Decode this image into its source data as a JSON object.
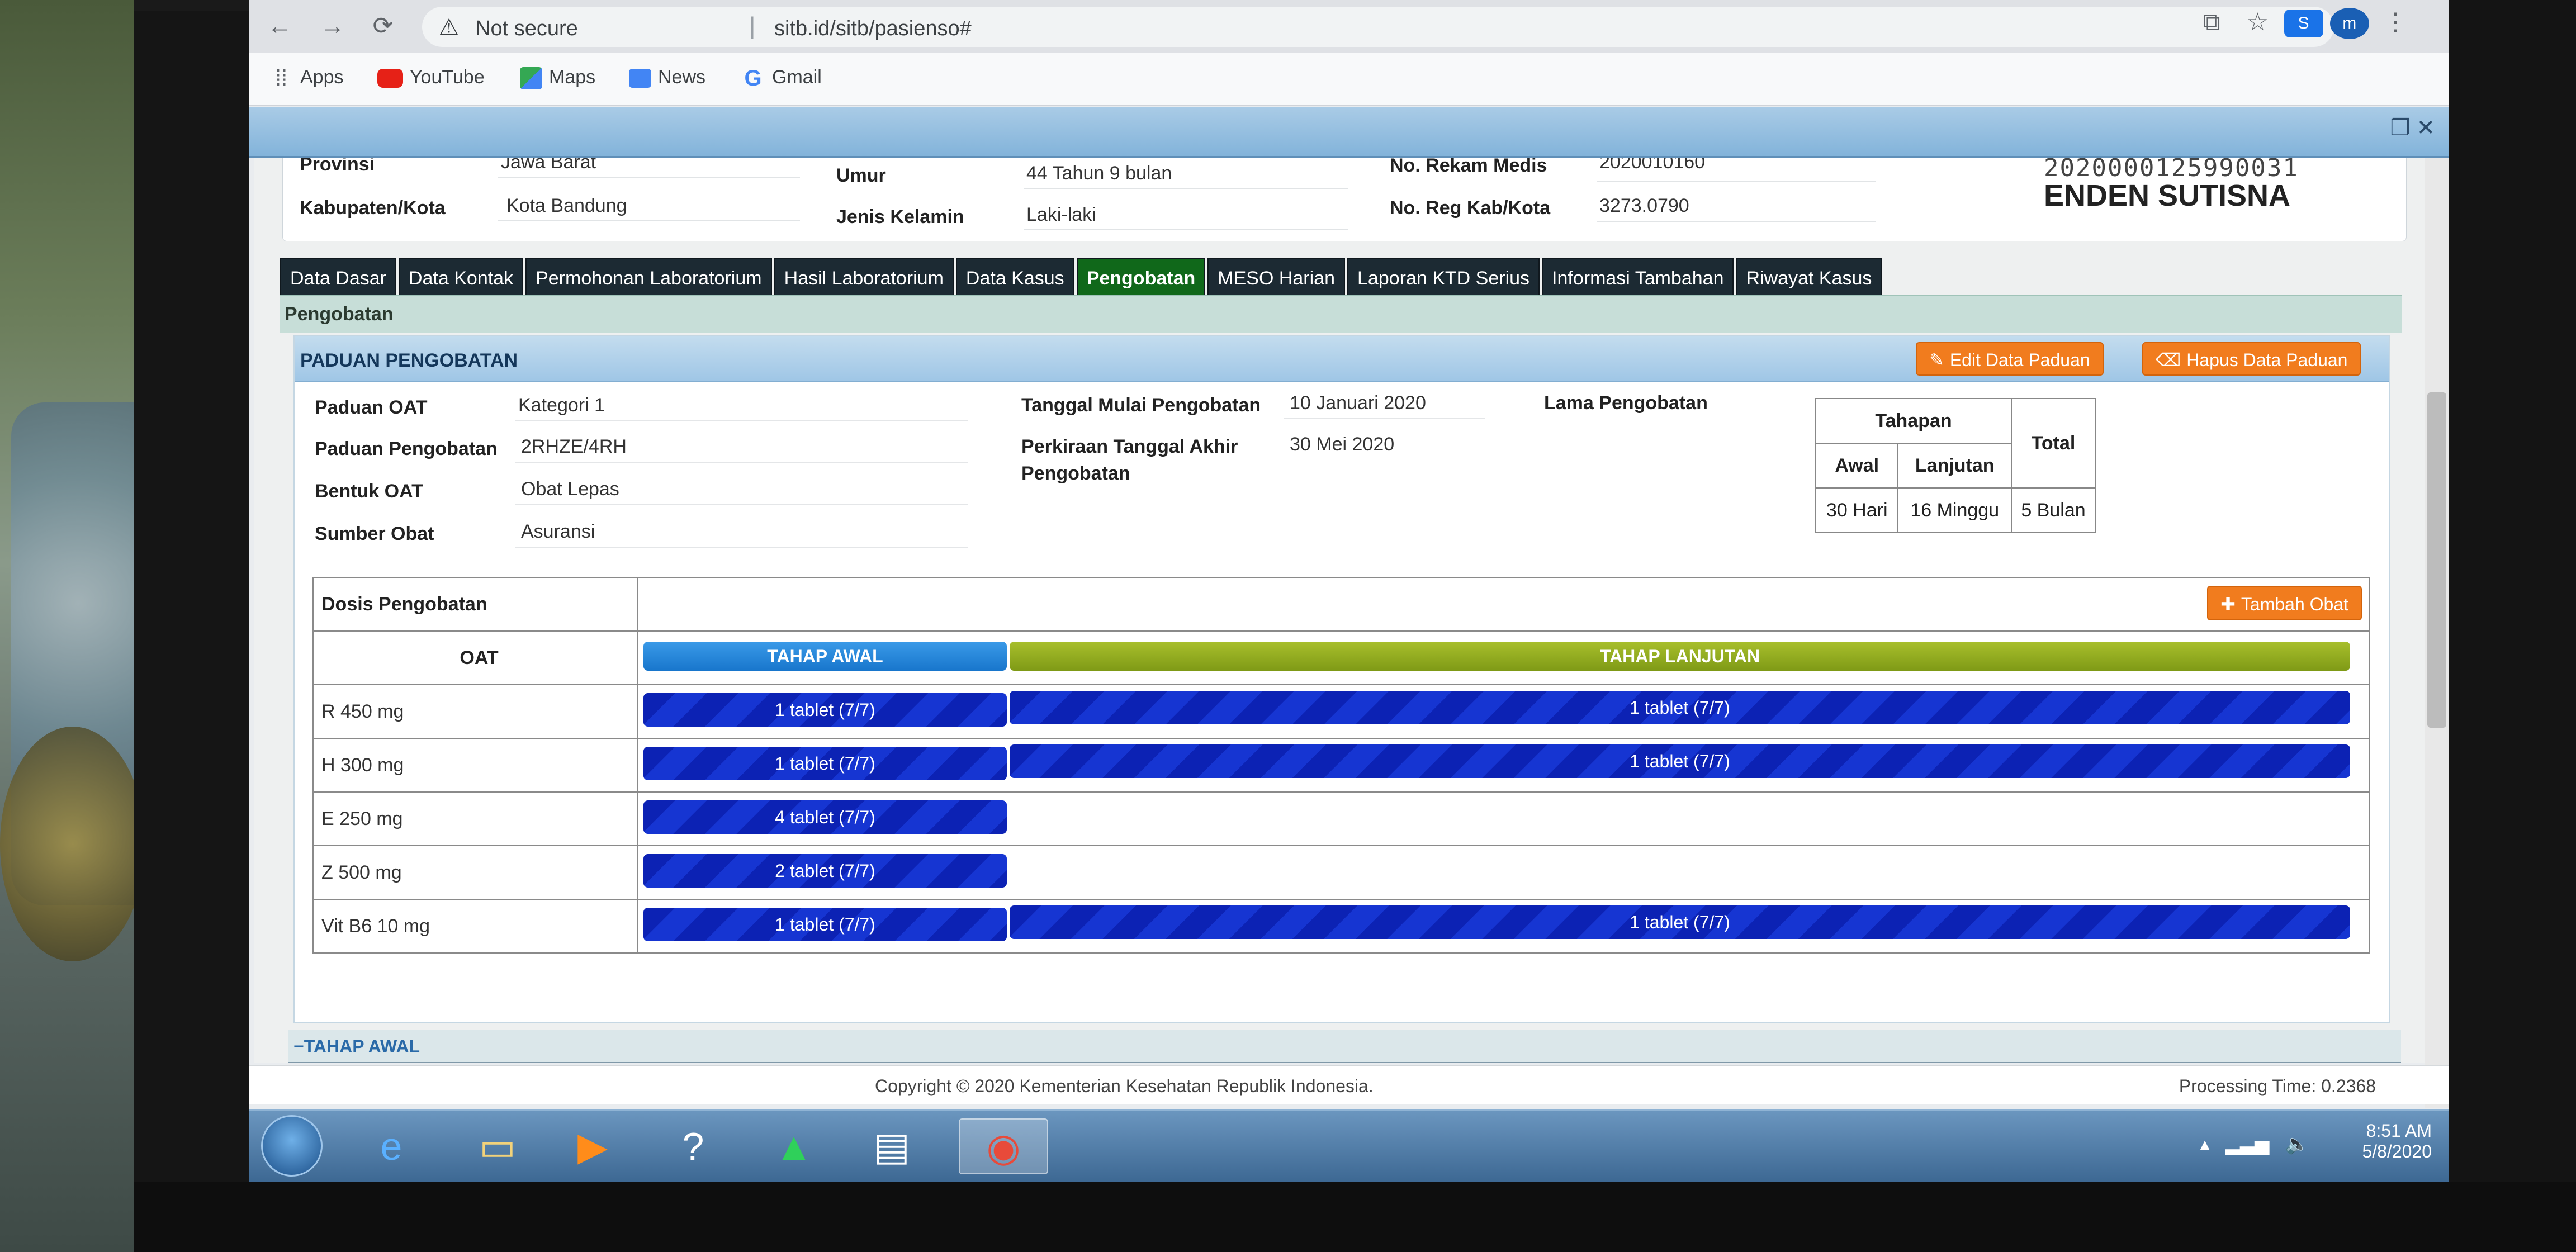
{
  "browser": {
    "nav": {
      "back": "←",
      "forward": "→",
      "reload": "⟳"
    },
    "security": "Not secure",
    "url": "sitb.id/sitb/pasienso#",
    "profile_initial": "m",
    "skype_letter": "S",
    "bookmarks": [
      {
        "label": "Apps",
        "icon": "apps-grid-icon",
        "color": "#5f6368"
      },
      {
        "label": "YouTube",
        "icon": "youtube-icon",
        "color": "#e62117"
      },
      {
        "label": "Maps",
        "icon": "maps-icon",
        "color": "#34a853"
      },
      {
        "label": "News",
        "icon": "news-icon",
        "color": "#4285f4"
      },
      {
        "label": "Gmail",
        "icon": "google-icon",
        "color": "#4285f4"
      }
    ]
  },
  "patient": {
    "provinsi_label": "Provinsi",
    "provinsi": "Jawa Barat",
    "kabupaten_label": "Kabupaten/Kota",
    "kabupaten": "Kota Bandung",
    "umur_label": "Umur",
    "umur": "44 Tahun 9 bulan",
    "jk_label": "Jenis Kelamin",
    "jk": "Laki-laki",
    "rm_label": "No. Rekam Medis",
    "rm": "2020010160",
    "reg_label": "No. Reg Kab/Kota",
    "reg": "3273.0790",
    "id_number": "2020000125990031",
    "name": "ENDEN SUTISNA"
  },
  "tabs": [
    "Data Dasar",
    "Data Kontak",
    "Permohonan Laboratorium",
    "Hasil Laboratorium",
    "Data Kasus",
    "Pengobatan",
    "MESO Harian",
    "Laporan KTD Serius",
    "Informasi Tambahan",
    "Riwayat Kasus"
  ],
  "active_tab": "Pengobatan",
  "section_title": "Pengobatan",
  "panel": {
    "title": "PADUAN PENGOBATAN",
    "edit_button": "Edit Data Paduan",
    "hapus_button": "Hapus Data Paduan",
    "fields": {
      "paduan_oat_label": "Paduan OAT",
      "paduan_oat": "Kategori 1",
      "paduan_pengobatan_label": "Paduan Pengobatan",
      "paduan_pengobatan": "2RHZE/4RH",
      "bentuk_oat_label": "Bentuk OAT",
      "bentuk_oat": "Obat Lepas",
      "sumber_obat_label": "Sumber Obat",
      "sumber_obat": "Asuransi",
      "tgl_mulai_label": "Tanggal Mulai Pengobatan",
      "tgl_mulai": "10 Januari 2020",
      "tgl_akhir_label_1": "Perkiraan Tanggal Akhir",
      "tgl_akhir_label_2": "Pengobatan",
      "tgl_akhir": "30 Mei 2020",
      "lama_label": "Lama Pengobatan"
    },
    "lama_table": {
      "tahapan": "Tahapan",
      "total": "Total",
      "awal": "Awal",
      "lanjutan": "Lanjutan",
      "awal_value": "30 Hari",
      "lanjutan_value": "16 Minggu",
      "total_value": "5 Bulan"
    },
    "dosis": {
      "header": "Dosis Pengobatan",
      "tambah_button": "Tambah Obat",
      "oat_label": "OAT",
      "phase_awal": "TAHAP AWAL",
      "phase_lanjutan": "TAHAP LANJUTAN",
      "rows": [
        {
          "name": "R 450 mg",
          "awal": "1 tablet (7/7)",
          "lanjutan": "1 tablet (7/7)"
        },
        {
          "name": "H 300 mg",
          "awal": "1 tablet (7/7)",
          "lanjutan": "1 tablet (7/7)"
        },
        {
          "name": "E 250 mg",
          "awal": "4 tablet (7/7)",
          "lanjutan": null
        },
        {
          "name": "Z 500 mg",
          "awal": "2 tablet (7/7)",
          "lanjutan": null
        },
        {
          "name": "Vit B6 10 mg",
          "awal": "1 tablet (7/7)",
          "lanjutan": "1 tablet (7/7)"
        }
      ]
    }
  },
  "tahap_awal_strip": "−TAHAP AWAL",
  "footer": {
    "copyright": "Copyright © 2020 Kementerian Kesehatan Republik Indonesia.",
    "processing": "Processing Time: 0.2368"
  },
  "taskbar": {
    "time": "8:51 AM",
    "date": "5/8/2020"
  },
  "colors": {
    "tab_bg": "#1c2a33",
    "tab_active": "#10681a",
    "orange_btn": "#f17c1e",
    "bar_blue": "#0c22b4",
    "phase_awal": "#1876cc",
    "phase_lanjutan": "#8aa51c"
  }
}
